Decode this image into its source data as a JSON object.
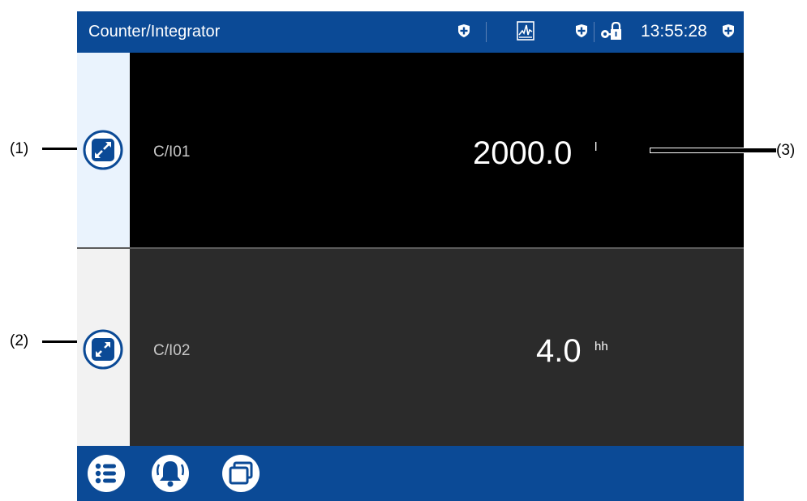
{
  "header": {
    "title": "Counter/Integrator",
    "time": "13:55:28"
  },
  "callouts": {
    "c1": "(1)",
    "c2": "(2)",
    "c3": "(3)"
  },
  "channels": [
    {
      "tag": "C/I01",
      "value": "2000.0",
      "unit": "l"
    },
    {
      "tag": "C/I02",
      "value": "4.0",
      "unit": "hh"
    }
  ],
  "icons": [
    "shield-plus-icon",
    "trend-icon",
    "shield-plus-icon",
    "lock-key-icon",
    "shield-plus-icon",
    "collapse-icon",
    "expand-icon",
    "menu-list-icon",
    "alarm-bell-icon",
    "windows-icon"
  ],
  "colors": {
    "accent": "#0b4a96",
    "row1_bg": "#000000",
    "row2_bg": "#2b2b2b"
  }
}
